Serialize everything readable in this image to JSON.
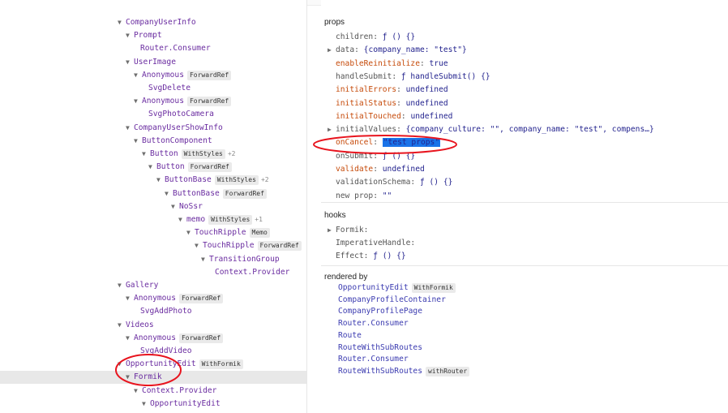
{
  "tree": {
    "rows": [
      {
        "name": "CompanyUserInfo",
        "arrow": "▼",
        "badge": "",
        "plus": ""
      },
      {
        "name": "Prompt",
        "arrow": "▼",
        "badge": "",
        "plus": ""
      },
      {
        "name": "Router.Consumer",
        "arrow": "",
        "badge": "",
        "plus": ""
      },
      {
        "name": "UserImage",
        "arrow": "▼",
        "badge": "",
        "plus": ""
      },
      {
        "name": "Anonymous",
        "arrow": "▼",
        "badge": "ForwardRef",
        "plus": ""
      },
      {
        "name": "SvgDelete",
        "arrow": "",
        "badge": "",
        "plus": ""
      },
      {
        "name": "Anonymous",
        "arrow": "▼",
        "badge": "ForwardRef",
        "plus": ""
      },
      {
        "name": "SvgPhotoCamera",
        "arrow": "",
        "badge": "",
        "plus": ""
      },
      {
        "name": "CompanyUserShowInfo",
        "arrow": "▼",
        "badge": "",
        "plus": ""
      },
      {
        "name": "ButtonComponent",
        "arrow": "▼",
        "badge": "",
        "plus": ""
      },
      {
        "name": "Button",
        "arrow": "▼",
        "badge": "WithStyles",
        "plus": "+2"
      },
      {
        "name": "Button",
        "arrow": "▼",
        "badge": "ForwardRef",
        "plus": ""
      },
      {
        "name": "ButtonBase",
        "arrow": "▼",
        "badge": "WithStyles",
        "plus": "+2"
      },
      {
        "name": "ButtonBase",
        "arrow": "▼",
        "badge": "ForwardRef",
        "plus": ""
      },
      {
        "name": "NoSsr",
        "arrow": "▼",
        "badge": "",
        "plus": ""
      },
      {
        "name": "memo",
        "arrow": "▼",
        "badge": "WithStyles",
        "plus": "+1"
      },
      {
        "name": "TouchRipple",
        "arrow": "▼",
        "badge": "Memo",
        "plus": ""
      },
      {
        "name": "TouchRipple",
        "arrow": "▼",
        "badge": "ForwardRef",
        "plus": ""
      },
      {
        "name": "TransitionGroup",
        "arrow": "▼",
        "badge": "",
        "plus": ""
      },
      {
        "name": "Context.Provider",
        "arrow": "",
        "badge": "",
        "plus": ""
      },
      {
        "name": "Gallery",
        "arrow": "▼",
        "badge": "",
        "plus": ""
      },
      {
        "name": "Anonymous",
        "arrow": "▼",
        "badge": "ForwardRef",
        "plus": ""
      },
      {
        "name": "SvgAddPhoto",
        "arrow": "",
        "badge": "",
        "plus": ""
      },
      {
        "name": "Videos",
        "arrow": "▼",
        "badge": "",
        "plus": ""
      },
      {
        "name": "Anonymous",
        "arrow": "▼",
        "badge": "ForwardRef",
        "plus": ""
      },
      {
        "name": "SvgAddVideo",
        "arrow": "",
        "badge": "",
        "plus": ""
      },
      {
        "name": "OpportunityEdit",
        "arrow": "▼",
        "badge": "WithFormik",
        "plus": ""
      },
      {
        "name": "Formik",
        "arrow": "▼",
        "badge": "",
        "plus": ""
      },
      {
        "name": "Context.Provider",
        "arrow": "▼",
        "badge": "",
        "plus": ""
      },
      {
        "name": "OpportunityEdit",
        "arrow": "▼",
        "badge": "",
        "plus": ""
      }
    ]
  },
  "props": {
    "title": "props",
    "rows": [
      {
        "key": "children",
        "value": "ƒ () {}",
        "expand": "",
        "changed": false
      },
      {
        "key": "data",
        "value": "{company_name: \"test\"}",
        "expand": "▶",
        "changed": false
      },
      {
        "key": "enableReinitialize",
        "value": "true",
        "expand": "",
        "changed": true
      },
      {
        "key": "handleSubmit",
        "value": "ƒ handleSubmit() {}",
        "expand": "",
        "changed": false
      },
      {
        "key": "initialErrors",
        "value": "undefined",
        "expand": "",
        "changed": true
      },
      {
        "key": "initialStatus",
        "value": "undefined",
        "expand": "",
        "changed": true
      },
      {
        "key": "initialTouched",
        "value": "undefined",
        "expand": "",
        "changed": true
      },
      {
        "key": "initialValues",
        "value": "{company_culture: \"\", company_name: \"test\", compens…}",
        "expand": "▶",
        "changed": false
      },
      {
        "key": "onCancel",
        "value": "\"test props\"",
        "expand": "",
        "changed": true
      },
      {
        "key": "onSubmit",
        "value": "ƒ () {}",
        "expand": "",
        "changed": false
      },
      {
        "key": "validate",
        "value": "undefined",
        "expand": "",
        "changed": true
      },
      {
        "key": "validationSchema",
        "value": "ƒ () {}",
        "expand": "",
        "changed": false
      },
      {
        "key": "new prop",
        "value": "\"\"",
        "expand": "",
        "changed": false
      }
    ]
  },
  "hooks": {
    "title": "hooks",
    "rows": [
      {
        "key": "Formik",
        "value": "",
        "expand": "▶"
      },
      {
        "key": "ImperativeHandle",
        "value": "",
        "expand": ""
      },
      {
        "key": "Effect",
        "value": "ƒ () {}",
        "expand": ""
      }
    ]
  },
  "rendered_by": {
    "title": "rendered by",
    "items": [
      {
        "name": "OpportunityEdit",
        "badge": "WithFormik"
      },
      {
        "name": "CompanyProfileContainer",
        "badge": ""
      },
      {
        "name": "CompanyProfilePage",
        "badge": ""
      },
      {
        "name": "Router.Consumer",
        "badge": ""
      },
      {
        "name": "Route",
        "badge": ""
      },
      {
        "name": "RouteWithSubRoutes",
        "badge": ""
      },
      {
        "name": "Router.Consumer",
        "badge": ""
      },
      {
        "name": "RouteWithSubRoutes",
        "badge": "withRouter"
      }
    ]
  },
  "annotation_color": "#e8141e"
}
